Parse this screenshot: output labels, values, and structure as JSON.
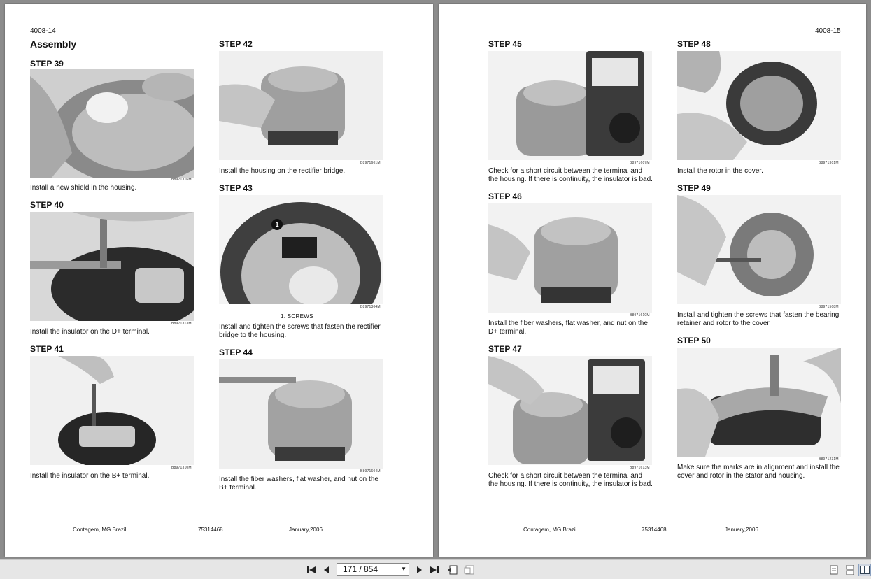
{
  "left_page": {
    "page_number": "4008-14",
    "section_title": "Assembly",
    "steps": [
      {
        "title": "STEP 39",
        "code": "B8971316M",
        "caption": "Install a new shield in the housing."
      },
      {
        "title": "STEP 40",
        "code": "B8971313M",
        "caption": "Install the insulator on the D+ terminal."
      },
      {
        "title": "STEP 41",
        "code": "B8971310M",
        "caption": "Install the insulator on the B+ terminal."
      },
      {
        "title": "STEP 42",
        "code": "B8971601M",
        "caption": "Install the housing on the rectifier bridge."
      },
      {
        "title": "STEP 43",
        "code": "B8971304M",
        "callout_number": "1",
        "callout": "1. SCREWS",
        "caption": "Install and tighten the screws that fasten the rectifier bridge to the housing."
      },
      {
        "title": "STEP 44",
        "code": "B8971604M",
        "caption": "Install the fiber washers, flat washer, and nut on the B+ terminal."
      }
    ],
    "footer": {
      "location": "Contagem, MG Brazil",
      "doc_number": "75314468",
      "date": "January,2006"
    }
  },
  "right_page": {
    "page_number": "4008-15",
    "steps": [
      {
        "title": "STEP 45",
        "code": "B8971607M",
        "caption": "Check for a short circuit between the terminal and the housing. If there is continuity, the insulator is bad."
      },
      {
        "title": "STEP 46",
        "code": "B8971610M",
        "caption": "Install the fiber washers, flat washer, and nut on the D+ terminal."
      },
      {
        "title": "STEP 47",
        "code": "B8971613M",
        "caption": "Check for a short circuit between the terminal and the housing. If there is continuity, the insulator is bad."
      },
      {
        "title": "STEP 48",
        "code": "B8971301M",
        "caption": "Install the rotor in the cover."
      },
      {
        "title": "STEP 49",
        "code": "B8971508M",
        "caption": "Install and tighten the screws that fasten the bearing retainer and rotor to the cover."
      },
      {
        "title": "STEP 50",
        "code": "B8971231M",
        "caption": "Make sure the marks are in alignment and install the cover and rotor in the stator and housing."
      }
    ],
    "footer": {
      "location": "Contagem, MG Brazil",
      "doc_number": "75314468",
      "date": "January,2006"
    }
  },
  "toolbar": {
    "page_indicator": "171 / 854",
    "icons": [
      "first-page-icon",
      "previous-page-icon",
      "next-page-icon",
      "last-page-icon",
      "fit-page-icon",
      "fit-width-icon",
      "single-page-view-icon",
      "continuous-view-icon",
      "two-page-view-icon"
    ]
  }
}
